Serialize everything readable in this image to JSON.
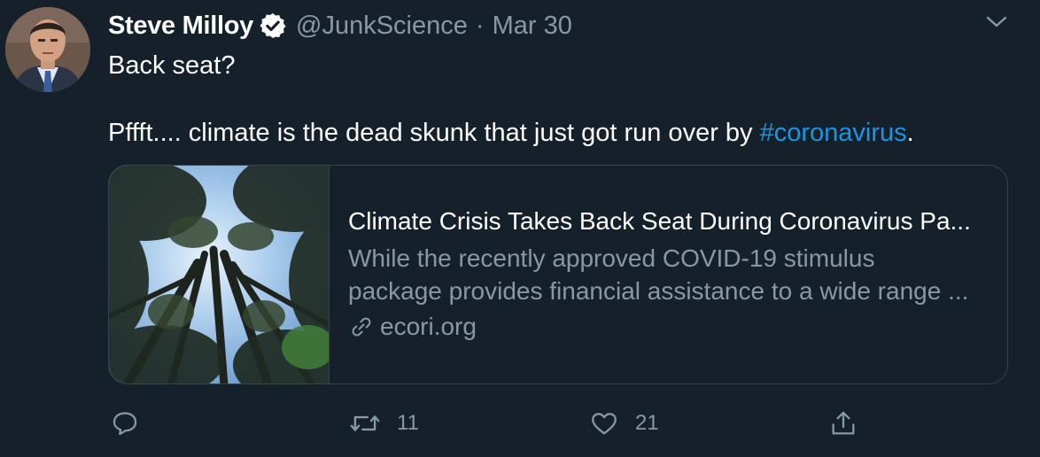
{
  "tweet": {
    "author_name": "Steve Milloy",
    "author_handle": "@JunkScience",
    "separator": "·",
    "date": "Mar 30",
    "text_line1": "Back seat?",
    "text_line2_prefix": "Pffft.... climate is the dead skunk that just got run over by ",
    "hashtag": "#coronavirus",
    "text_line2_suffix": "."
  },
  "card": {
    "title": "Climate Crisis Takes Back Seat During Coronavirus Pa...",
    "description_line1": "While the recently approved COVID-19 stimulus",
    "description_line2": "package provides financial assistance to a wide range ...",
    "domain": "ecori.org"
  },
  "actions": {
    "retweet_count": "11",
    "like_count": "21"
  },
  "colors": {
    "background": "#15202b",
    "secondary_text": "#8899a6",
    "link": "#1b95e0",
    "border": "#38444d"
  }
}
